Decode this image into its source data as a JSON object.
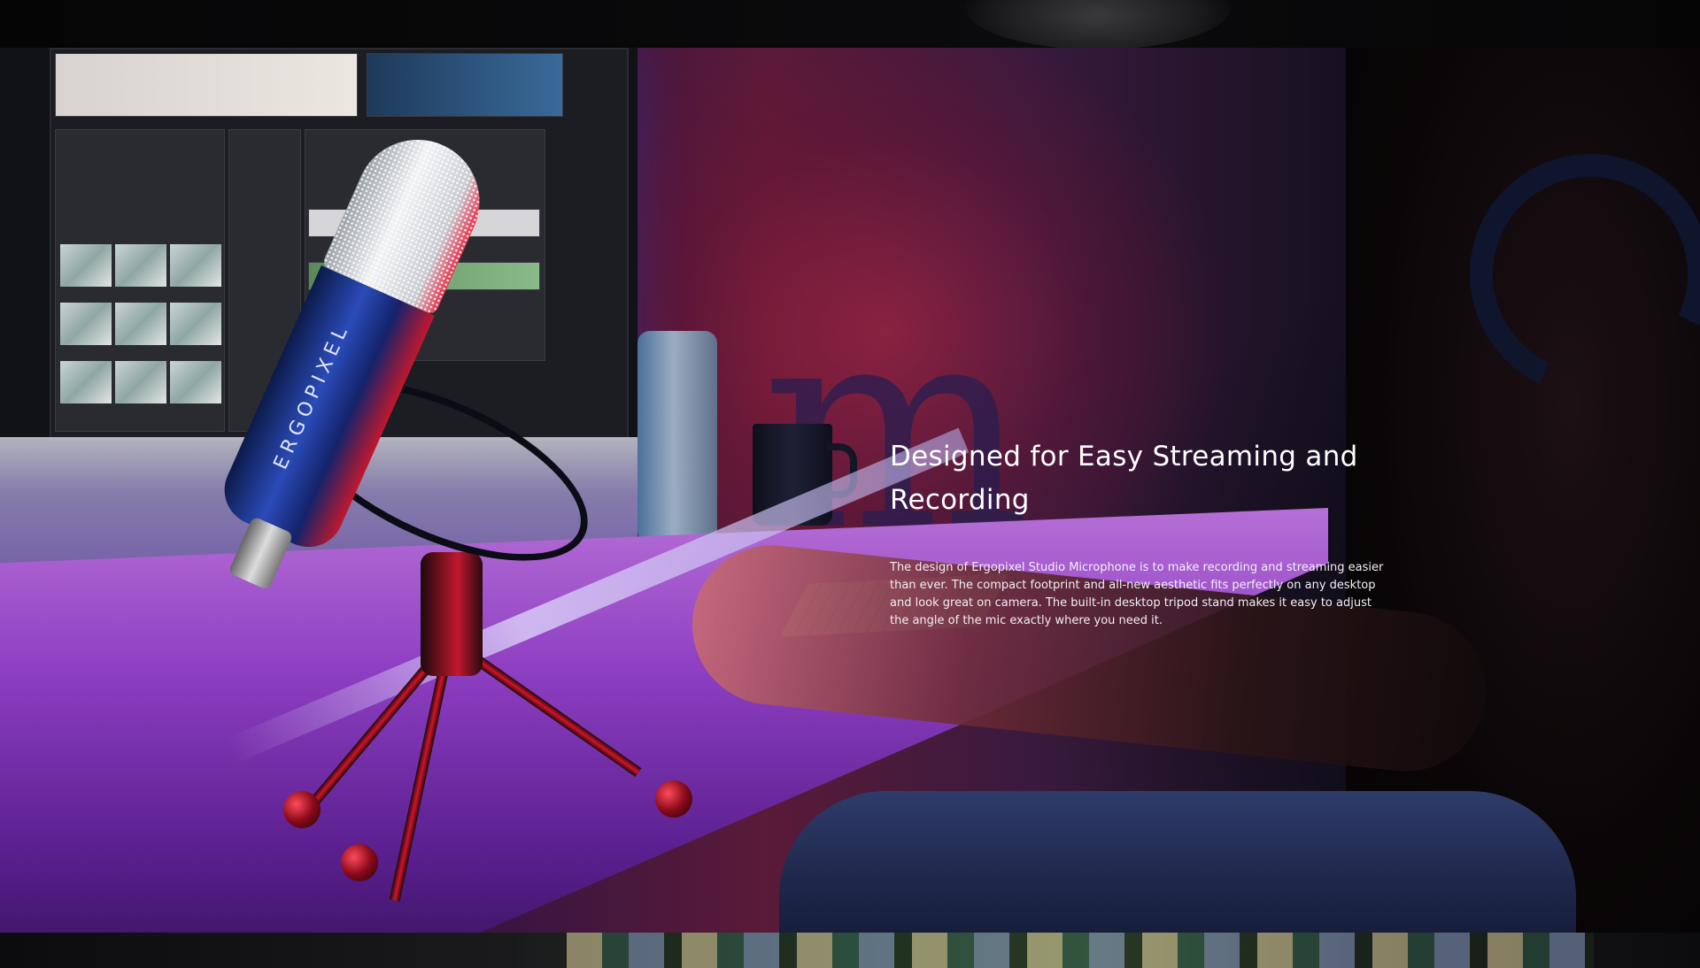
{
  "hero": {
    "heading": "Designed for Easy Streaming and Recording",
    "description": "The design of Ergopixel Studio Microphone is to make recording and streaming easier than ever. The compact footprint and all-new aesthetic fits perfectly on any desktop and look great on camera. The built-in desktop tripod stand makes it easy to adjust the angle of the mic exactly where you need it."
  },
  "product_image": {
    "brand_mark": "ERGOPIXEL",
    "decor_letter": "m"
  },
  "colors": {
    "text": "#ffffff",
    "accent_red": "#d4122a",
    "accent_blue": "#2a4bb8",
    "background": "#08080a"
  }
}
